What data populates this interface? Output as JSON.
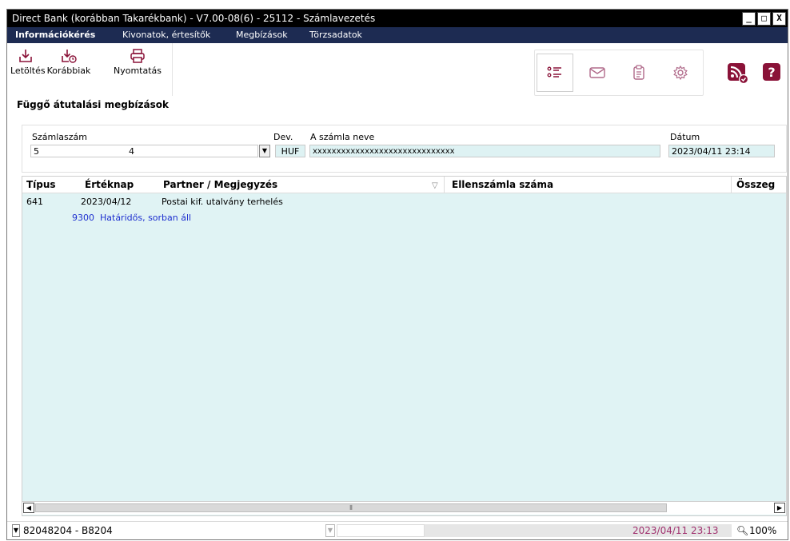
{
  "window": {
    "title": "Direct Bank (korábban Takarékbank) - V7.00-08(6) - 25112 - Számlavezetés",
    "minimize": "_",
    "maximize": "□",
    "close": "X"
  },
  "menu": {
    "items": [
      "Információkérés",
      "Kivonatok, értesítők",
      "Megbízások",
      "Törzsadatok"
    ],
    "active": "Információkérés"
  },
  "toolbar": {
    "download": "Letöltés",
    "previous": "Korábbiak",
    "print": "Nyomtatás"
  },
  "section_title": "Függő átutalási megbízások",
  "account": {
    "number_label": "Számlaszám",
    "number_part1": "5",
    "number_part2": "4",
    "currency_label": "Dev.",
    "currency": "HUF",
    "name_label": "A számla neve",
    "name": "xxxxxxxxxxxxxxxxxxxxxxxxxxxxxx",
    "date_label": "Dátum",
    "date": "2023/04/11 23:14"
  },
  "grid": {
    "columns": [
      "Típus",
      "Értéknap",
      "Partner / Megjegyzés",
      "Ellenszámla száma",
      "Összeg"
    ],
    "rows": [
      {
        "type": "641",
        "value_date": "2023/04/12",
        "partner": "Postai kif. utalvány terhelés",
        "status": "9300  Határidős, sorban áll"
      }
    ]
  },
  "statusbar": {
    "user": "82048204 - B8204",
    "datetime": "2023/04/11 23:13",
    "zoom": "100%"
  },
  "colors": {
    "title_bg": "#000000",
    "menu_bg": "#1d2b52",
    "grid_bg": "#e0f3f4",
    "status_link": "#1d2fcf",
    "status_datetime": "#a0306e",
    "rss_icon": "#8a1238"
  }
}
